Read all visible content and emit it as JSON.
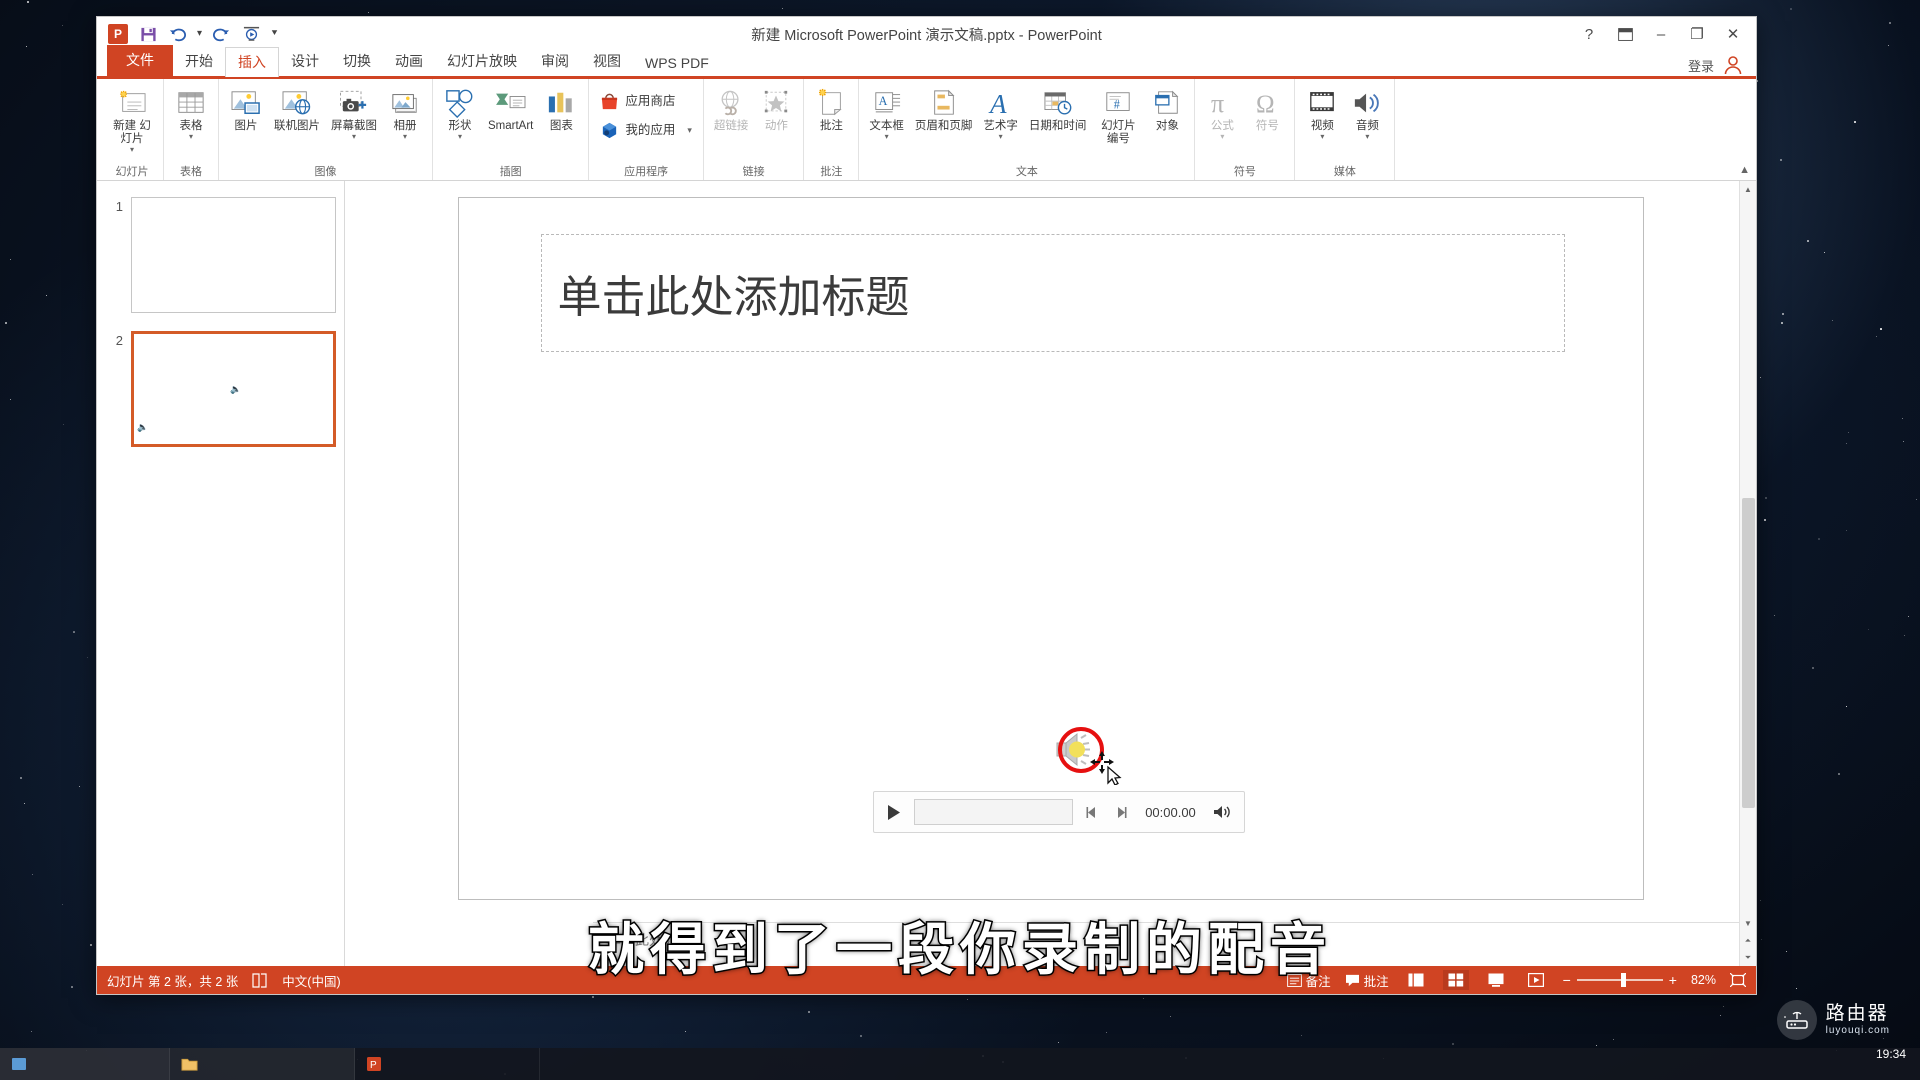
{
  "window": {
    "title": "新建 Microsoft PowerPoint 演示文稿.pptx - PowerPoint",
    "help_icon": "?",
    "ribbon_display_icon": "ribbon-options",
    "minimize_icon": "–",
    "restore_icon": "❐",
    "close_icon": "✕",
    "signin_label": "登录"
  },
  "quick_access": [
    {
      "name": "powerpoint-logo",
      "glyph": "P"
    },
    {
      "name": "save-icon",
      "glyph": "save"
    },
    {
      "name": "undo-icon",
      "glyph": "↶"
    },
    {
      "name": "redo-icon",
      "glyph": "↻"
    },
    {
      "name": "start-from-beginning-icon",
      "glyph": "slideshow"
    },
    {
      "name": "customize-qat-icon",
      "glyph": "▾"
    }
  ],
  "tabs": [
    {
      "label": "文件",
      "kind": "file"
    },
    {
      "label": "开始",
      "kind": "normal"
    },
    {
      "label": "插入",
      "kind": "active"
    },
    {
      "label": "设计",
      "kind": "normal"
    },
    {
      "label": "切换",
      "kind": "normal"
    },
    {
      "label": "动画",
      "kind": "normal"
    },
    {
      "label": "幻灯片放映",
      "kind": "normal"
    },
    {
      "label": "审阅",
      "kind": "normal"
    },
    {
      "label": "视图",
      "kind": "normal"
    },
    {
      "label": "WPS PDF",
      "kind": "normal"
    }
  ],
  "ribbon": {
    "groups": [
      {
        "label": "幻灯片",
        "layout": "normal",
        "items": [
          {
            "label": "新建\n幻灯片",
            "icon": "new-slide-icon",
            "dropdown": true,
            "two_line": true,
            "dimmed": false
          }
        ]
      },
      {
        "label": "表格",
        "layout": "normal",
        "items": [
          {
            "label": "表格",
            "icon": "table-icon",
            "dropdown": true,
            "two_line": false,
            "dimmed": false
          }
        ]
      },
      {
        "label": "图像",
        "layout": "normal",
        "items": [
          {
            "label": "图片",
            "icon": "picture-icon",
            "dropdown": false,
            "two_line": false,
            "dimmed": false
          },
          {
            "label": "联机图片",
            "icon": "online-picture-icon",
            "dropdown": false,
            "two_line": false,
            "dimmed": false
          },
          {
            "label": "屏幕截图",
            "icon": "screenshot-icon",
            "dropdown": true,
            "two_line": false,
            "dimmed": false
          },
          {
            "label": "相册",
            "icon": "photo-album-icon",
            "dropdown": true,
            "two_line": false,
            "dimmed": false
          }
        ]
      },
      {
        "label": "插图",
        "layout": "normal",
        "items": [
          {
            "label": "形状",
            "icon": "shapes-icon",
            "dropdown": true,
            "two_line": false,
            "dimmed": false
          },
          {
            "label": "SmartArt",
            "icon": "smartart-icon",
            "dropdown": false,
            "two_line": false,
            "dimmed": false
          },
          {
            "label": "图表",
            "icon": "chart-icon",
            "dropdown": false,
            "two_line": false,
            "dimmed": false
          }
        ]
      },
      {
        "label": "应用程序",
        "layout": "stacked",
        "items": [
          {
            "label": "应用商店",
            "icon": "store-icon",
            "dropdown": false,
            "two_line": false,
            "dimmed": false
          },
          {
            "label": "我的应用",
            "icon": "my-apps-icon",
            "dropdown": true,
            "two_line": false,
            "dimmed": false
          }
        ]
      },
      {
        "label": "链接",
        "layout": "normal",
        "items": [
          {
            "label": "超链接",
            "icon": "hyperlink-icon",
            "dropdown": false,
            "two_line": false,
            "dimmed": true
          },
          {
            "label": "动作",
            "icon": "action-icon",
            "dropdown": false,
            "two_line": false,
            "dimmed": true
          }
        ]
      },
      {
        "label": "批注",
        "layout": "normal",
        "items": [
          {
            "label": "批注",
            "icon": "comment-icon",
            "dropdown": false,
            "two_line": false,
            "dimmed": false
          }
        ]
      },
      {
        "label": "文本",
        "layout": "normal",
        "items": [
          {
            "label": "文本框",
            "icon": "textbox-icon",
            "dropdown": true,
            "two_line": false,
            "dimmed": false
          },
          {
            "label": "页眉和页脚",
            "icon": "header-footer-icon",
            "dropdown": false,
            "two_line": false,
            "dimmed": false
          },
          {
            "label": "艺术字",
            "icon": "wordart-icon",
            "dropdown": true,
            "two_line": false,
            "dimmed": false
          },
          {
            "label": "日期和时间",
            "icon": "date-time-icon",
            "dropdown": false,
            "two_line": false,
            "dimmed": false
          },
          {
            "label": "幻灯片\n编号",
            "icon": "slide-number-icon",
            "dropdown": false,
            "two_line": true,
            "dimmed": false
          },
          {
            "label": "对象",
            "icon": "object-icon",
            "dropdown": false,
            "two_line": false,
            "dimmed": false
          }
        ]
      },
      {
        "label": "符号",
        "layout": "normal",
        "items": [
          {
            "label": "公式",
            "icon": "equation-icon",
            "dropdown": true,
            "two_line": false,
            "dimmed": true
          },
          {
            "label": "符号",
            "icon": "symbol-icon",
            "dropdown": false,
            "two_line": false,
            "dimmed": true
          }
        ]
      },
      {
        "label": "媒体",
        "layout": "normal",
        "items": [
          {
            "label": "视频",
            "icon": "video-icon",
            "dropdown": true,
            "two_line": false,
            "dimmed": false
          },
          {
            "label": "音频",
            "icon": "audio-icon",
            "dropdown": true,
            "two_line": false,
            "dimmed": false
          }
        ]
      }
    ],
    "collapse_glyph": "▲"
  },
  "thumbnails": [
    {
      "number": "1",
      "selected": false,
      "has_audio": false
    },
    {
      "number": "2",
      "selected": true,
      "has_audio": true
    }
  ],
  "slide": {
    "title_placeholder": "单击此处添加标题",
    "audio_object_name": "audio-clip-icon"
  },
  "media_controls": {
    "play_glyph": "▶",
    "prev_glyph": "◀|",
    "next_glyph": "|▶",
    "time": "00:00.00",
    "volume_glyph": "volume-icon"
  },
  "notes": {
    "placeholder": "单击此处添"
  },
  "statusbar": {
    "slide_info": "幻灯片 第 2 张，共 2 张",
    "theme_icon": "theme-icon",
    "language": "中文(中国)",
    "notes_label": "备注",
    "comments_label": "批注",
    "views": [
      {
        "name": "normal-view",
        "glyph": "▤",
        "active": false
      },
      {
        "name": "slide-sorter-view",
        "glyph": "▦",
        "active": true
      },
      {
        "name": "reading-view",
        "glyph": "▥",
        "active": false
      },
      {
        "name": "slideshow-view",
        "glyph": "▣",
        "active": false
      }
    ],
    "zoom_out": "−",
    "zoom_in": "+",
    "zoom_level": "82%",
    "fit_window_icon": "fit-slide-icon"
  },
  "subtitle": "就得到了一段你录制的配音",
  "watermark": {
    "title": "路由器",
    "subtitle": "luyouqi.com"
  },
  "taskbar": {
    "items": [
      {
        "label": "",
        "icon": "taskbar-item-icon"
      },
      {
        "label": "",
        "icon": "file-explorer-icon"
      },
      {
        "label": "",
        "icon": "powerpoint-taskbar-icon"
      }
    ],
    "clock": "19:34"
  },
  "colors": {
    "accent": "#d04423",
    "selection": "#e61010",
    "thumb_selected_border": "#d45b28"
  }
}
